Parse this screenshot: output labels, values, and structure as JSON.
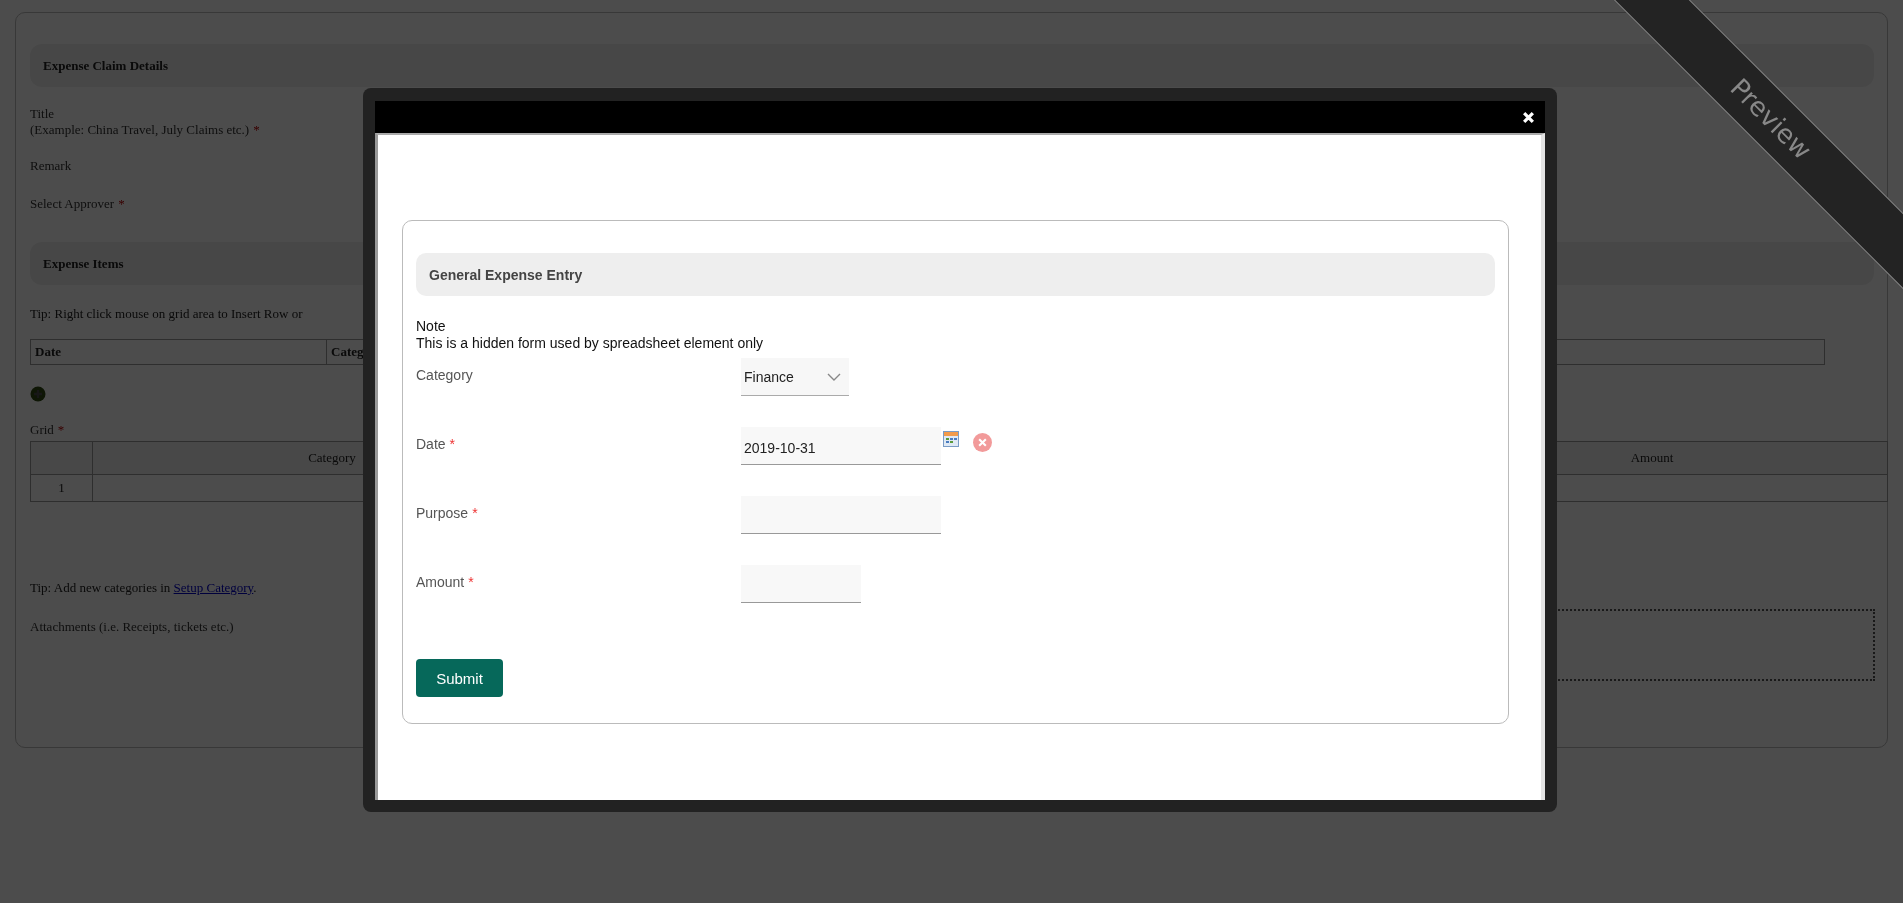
{
  "required_mark": "*",
  "claim_details": {
    "heading": "Expense Claim Details",
    "fields": [
      {
        "label": "Title",
        "hint": "(Example: China Travel, July Claims etc.)",
        "required": true
      },
      {
        "label": "Remark",
        "required": false
      },
      {
        "label": "Select Approver",
        "required": true
      }
    ]
  },
  "expense_items": {
    "heading": "Expense Items",
    "tip": "Tip: Right click mouse on grid area to Insert Row or",
    "items_table": {
      "columns": [
        "Date",
        "Categ"
      ]
    },
    "grid": {
      "label": "Grid",
      "required": true,
      "columns": [
        "Category",
        "Amount"
      ],
      "rows": [
        {
          "number": "1"
        }
      ]
    }
  },
  "category_tip": {
    "text": "Tip: Add new categories in ",
    "link": "Setup Category",
    "after": "."
  },
  "attachments_label": "Attachments (i.e. Receipts, tickets etc.)",
  "modal": {
    "card": {
      "heading": "General Expense Entry",
      "note_title": "Note",
      "note_text": "This is a hidden form used by spreadsheet element only",
      "fields": [
        {
          "kind": "select",
          "label": "Category",
          "required": false,
          "value": "Finance"
        },
        {
          "kind": "date",
          "label": "Date",
          "required": true,
          "value": "2019-10-31"
        },
        {
          "kind": "text",
          "label": "Purpose",
          "required": true
        },
        {
          "kind": "amount",
          "label": "Amount",
          "required": true
        }
      ],
      "submit": "Submit"
    }
  },
  "ribbon": {
    "label": "Preview"
  }
}
